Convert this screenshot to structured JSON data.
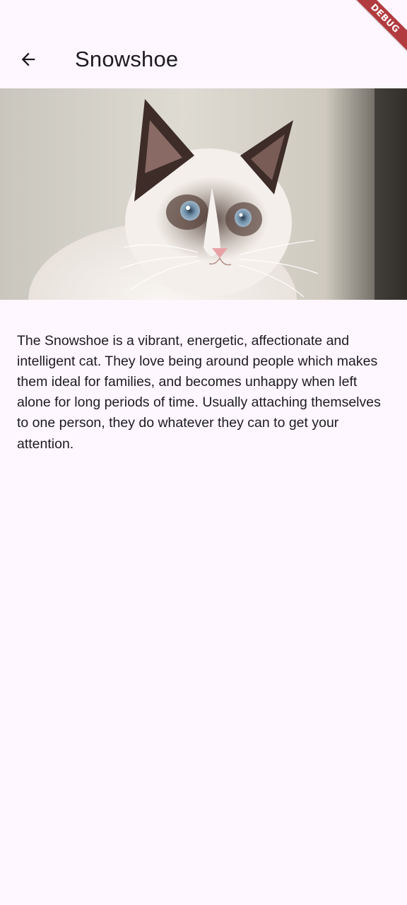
{
  "app_bar": {
    "title": "Snowshoe",
    "back_icon": "arrow-back-icon"
  },
  "hero_image": {
    "alt": "Snowshoe"
  },
  "description": "The Snowshoe is a vibrant, energetic, affectionate and intelligent cat. They love being around people which makes them ideal for families, and becomes unhappy when left alone for long periods of time. Usually attaching themselves to one person, they do whatever they can to get your attention.",
  "debug_banner": "DEBUG",
  "colors": {
    "background": "#FEF7FF",
    "text": "#1D1B20",
    "debug_ribbon": "#B13B3E"
  }
}
